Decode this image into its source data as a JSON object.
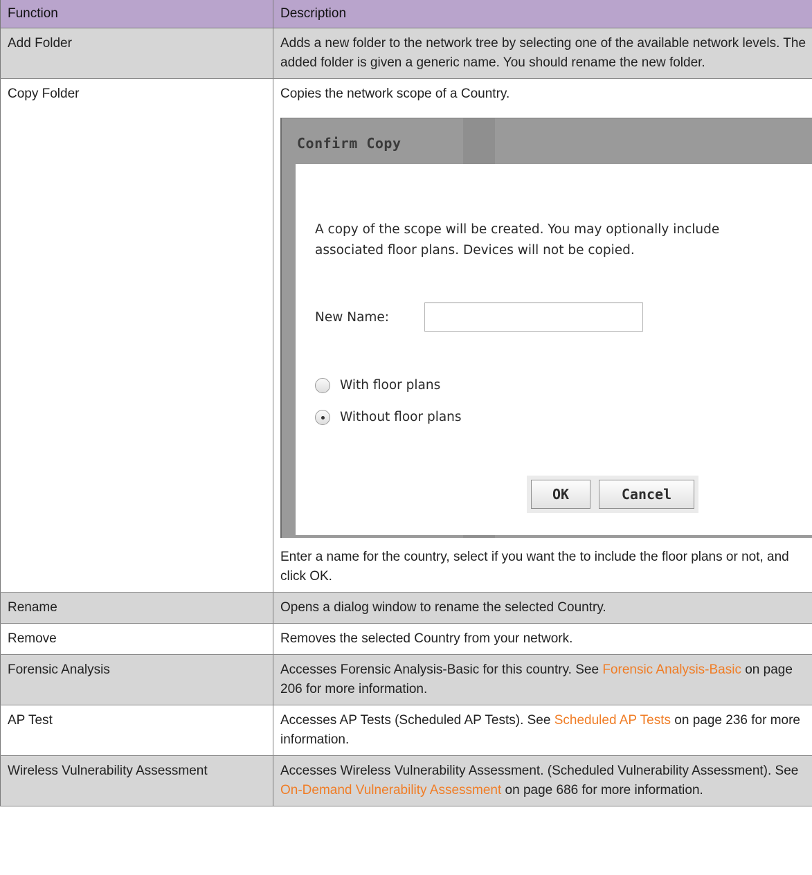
{
  "table": {
    "headers": {
      "function": "Function",
      "description": "Description"
    },
    "rows": [
      {
        "function": "Add Folder",
        "description": "Adds a new folder to the network tree by selecting one of the available network levels. The added folder is given a generic name. You should rename the new folder."
      },
      {
        "function": "Copy Folder",
        "description": "Copies the network scope of a Country.",
        "after": "Enter a name for the country, select if you want the to include the floor plans or not, and click OK."
      },
      {
        "function": "Rename",
        "description": "Opens a dialog window to rename the selected Country."
      },
      {
        "function": "Remove",
        "description": "Removes the selected Country from your network."
      },
      {
        "function": "Forensic Analysis",
        "pre": "Accesses Forensic Analysis-Basic for this country. See ",
        "link": "Forensic Analysis-Basic",
        "post": " on page 206 for more information."
      },
      {
        "function": "AP Test",
        "pre": "Accesses AP Tests (Scheduled AP Tests). See ",
        "link": "Scheduled AP Tests",
        "post": " on page 236 for more information."
      },
      {
        "function": "Wireless Vulnerability Assessment",
        "pre": "Accesses Wireless Vulnerability Assessment. (Scheduled Vulnerability Assessment). See ",
        "link": "On-Demand Vulnerability Assessment",
        "post": " on page 686 for more information."
      }
    ]
  },
  "dialog": {
    "title": "Confirm Copy",
    "message": "A copy of the scope will be created. You may optionally include\nassociated floor plans. Devices will not be copied.",
    "new_name_label": "New Name:",
    "new_name_value": "",
    "options": [
      {
        "label": "With floor plans",
        "selected": false
      },
      {
        "label": "Without floor plans",
        "selected": true
      }
    ],
    "ok_label": "OK",
    "cancel_label": "Cancel"
  },
  "colors": {
    "header_bg": "#b9a4cc",
    "shaded_row_bg": "#d6d6d6",
    "link": "#f07d26"
  }
}
